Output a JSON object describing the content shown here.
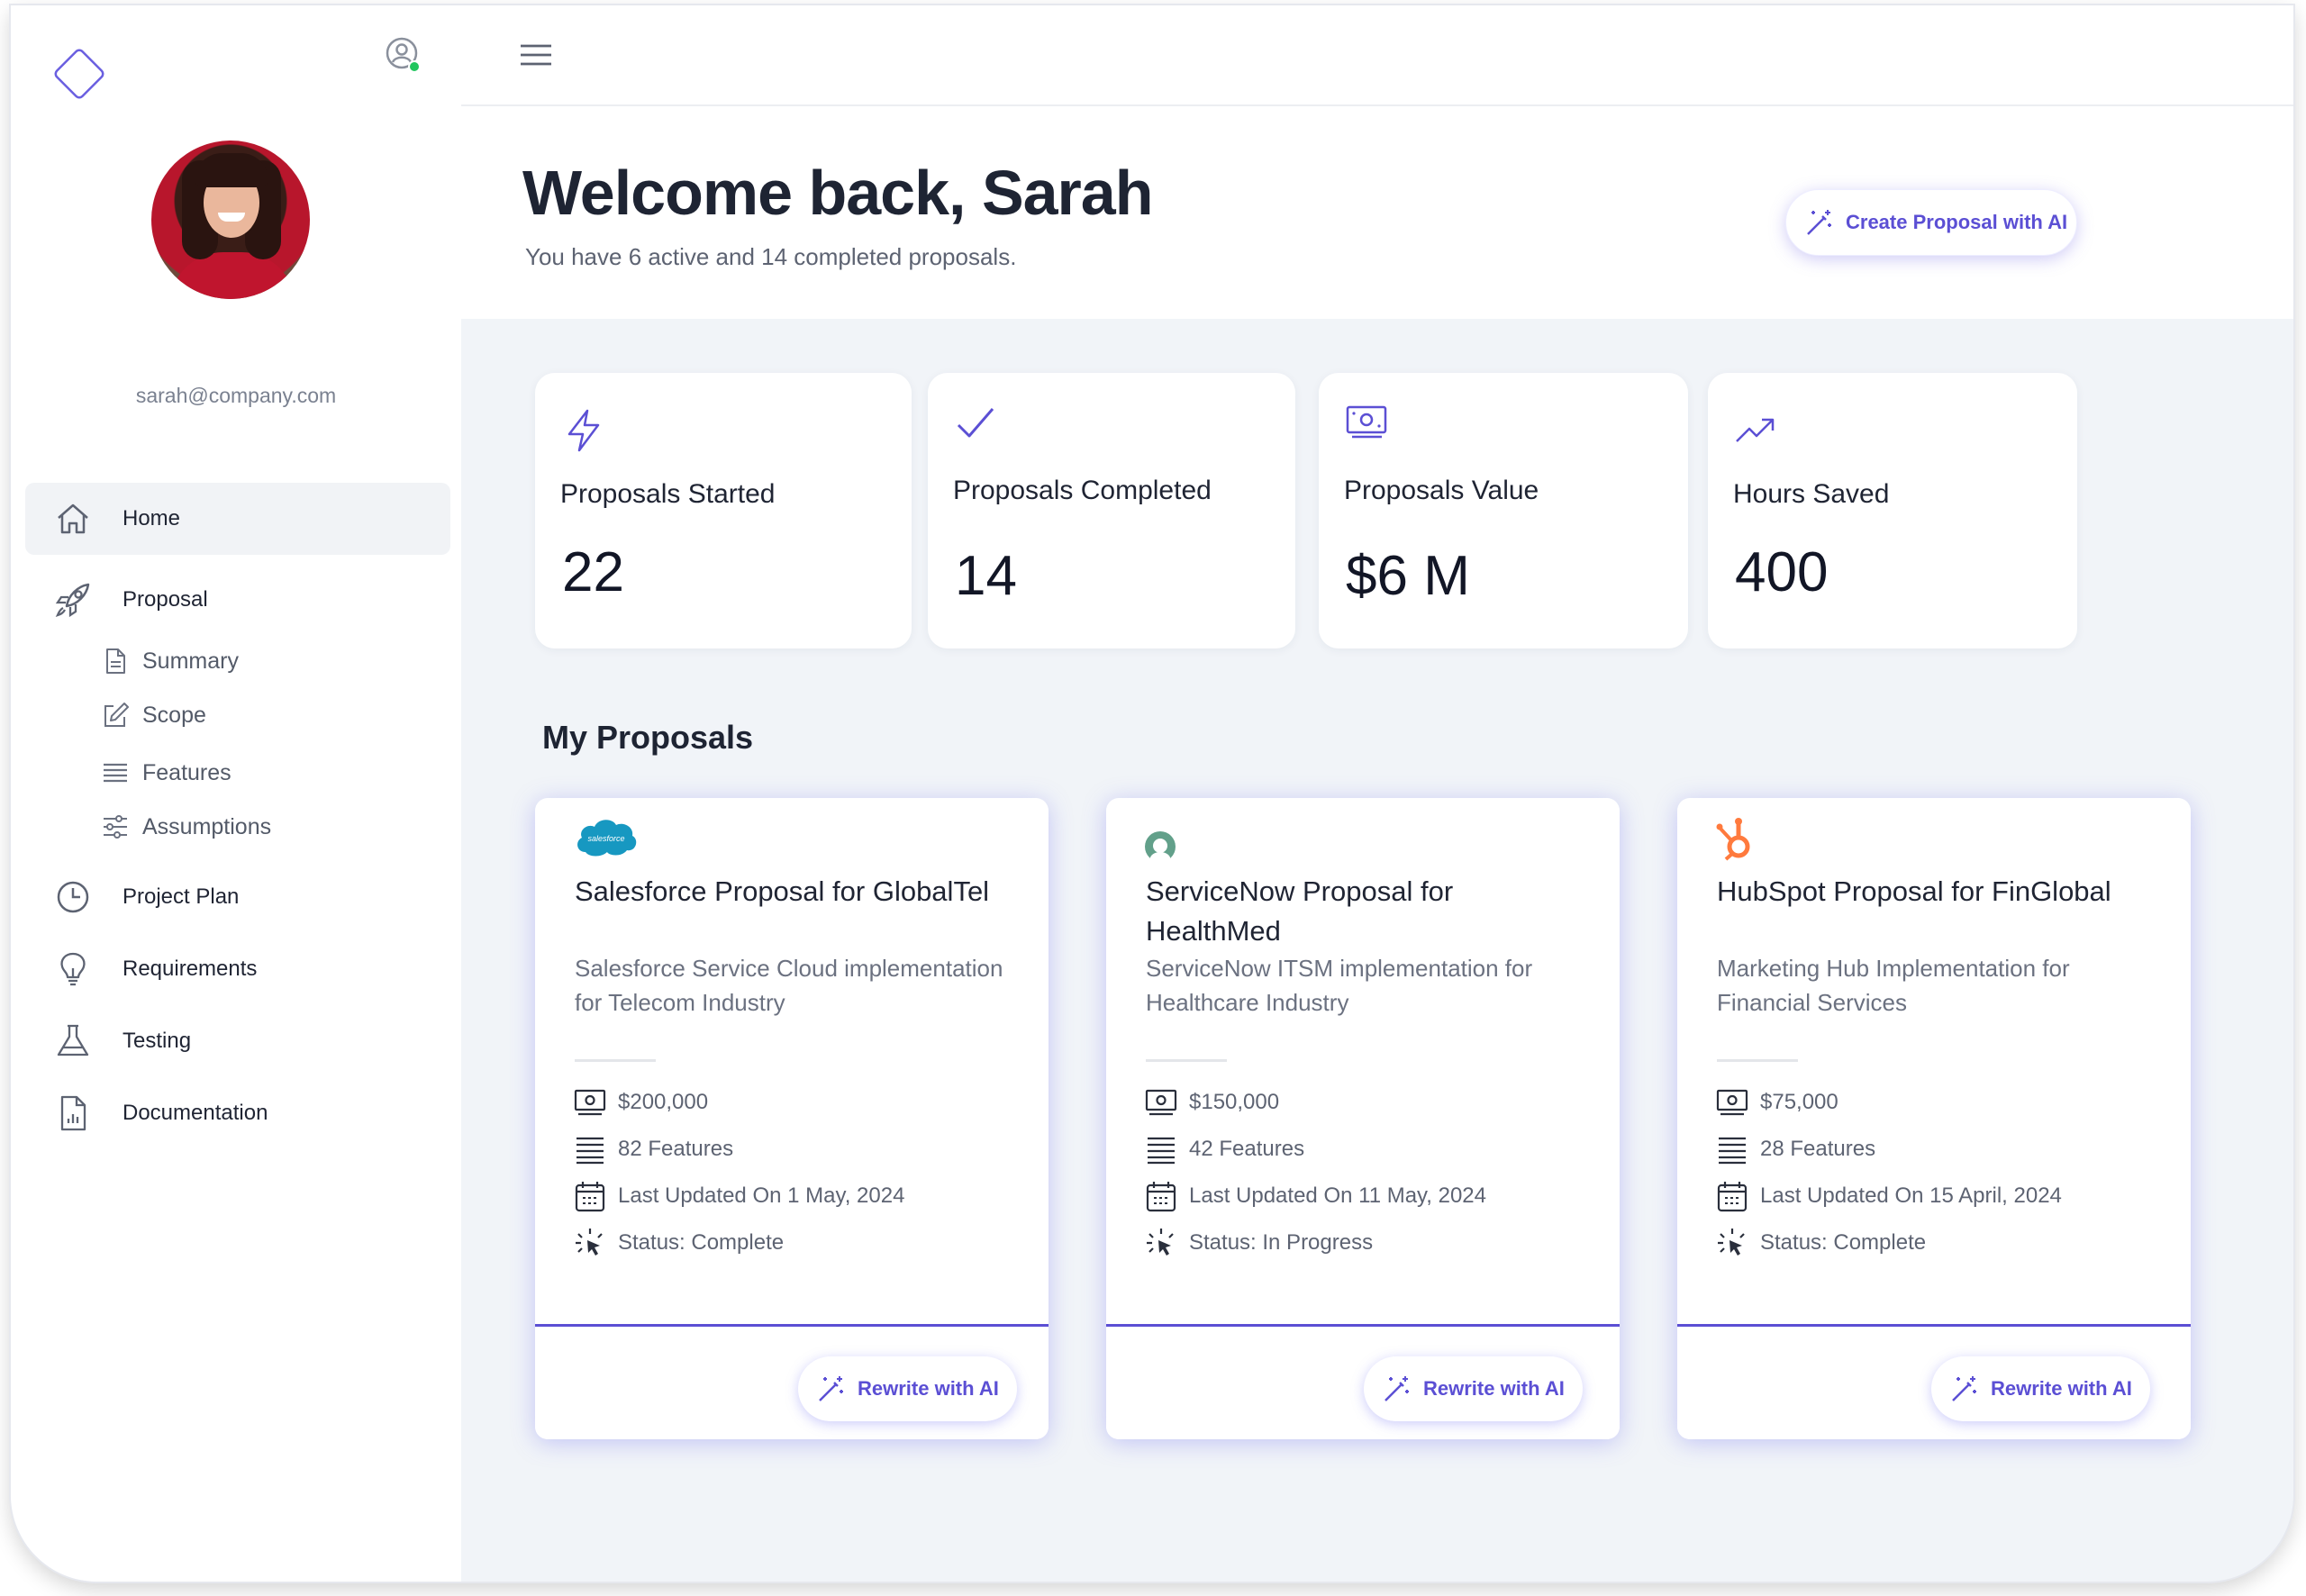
{
  "sidebar": {
    "email": "sarah@company.com",
    "nav": [
      {
        "label": "Home",
        "icon": "home-icon",
        "active": true
      },
      {
        "label": "Proposal",
        "icon": "rocket-icon"
      },
      {
        "label": "Project Plan",
        "icon": "clock-icon"
      },
      {
        "label": "Requirements",
        "icon": "lightbulb-icon"
      },
      {
        "label": "Testing",
        "icon": "flask-icon"
      },
      {
        "label": "Documentation",
        "icon": "document-chart-icon"
      }
    ],
    "sub": [
      {
        "label": "Summary",
        "icon": "document-icon"
      },
      {
        "label": "Scope",
        "icon": "edit-icon"
      },
      {
        "label": "Features",
        "icon": "list-icon"
      },
      {
        "label": "Assumptions",
        "icon": "sliders-icon"
      }
    ]
  },
  "header": {
    "title": "Welcome back, Sarah",
    "subtitle": "You have 6 active and 14 completed proposals.",
    "create_button": "Create Proposal with AI"
  },
  "stats": [
    {
      "label": "Proposals Started",
      "value": "22",
      "icon": "lightning-icon"
    },
    {
      "label": "Proposals Completed",
      "value": "14",
      "icon": "check-icon"
    },
    {
      "label": "Proposals Value",
      "value": "$6 M",
      "icon": "money-icon"
    },
    {
      "label": "Hours Saved",
      "value": "400",
      "icon": "trending-up-icon"
    }
  ],
  "section_title": "My Proposals",
  "proposals": [
    {
      "logo": "salesforce-logo",
      "logo_text": "salesforce",
      "title": "Salesforce Proposal for GlobalTel",
      "description": "Salesforce Service Cloud implementation for Telecom Industry",
      "value": "$200,000",
      "features": "82 Features",
      "updated": "Last Updated On 1 May, 2024",
      "status": "Status: Complete",
      "button": "Rewrite with AI"
    },
    {
      "logo": "servicenow-logo",
      "title": "ServiceNow Proposal for HealthMed",
      "description": "ServiceNow ITSM implementation for Healthcare Industry",
      "value": "$150,000",
      "features": "42 Features",
      "updated": "Last Updated On 11 May, 2024",
      "status": "Status: In Progress",
      "button": "Rewrite with AI"
    },
    {
      "logo": "hubspot-logo",
      "title": "HubSpot Proposal for FinGlobal",
      "description": "Marketing Hub Implementation for Financial Services",
      "value": "$75,000",
      "features": "28 Features",
      "updated": "Last Updated On 15 April, 2024",
      "status": "Status: Complete",
      "button": "Rewrite with AI"
    }
  ],
  "colors": {
    "accent": "#5b4fd4",
    "online": "#22c55e",
    "salesforce": "#1798c1",
    "servicenow": "#62a08a",
    "hubspot": "#ff7a3d"
  }
}
